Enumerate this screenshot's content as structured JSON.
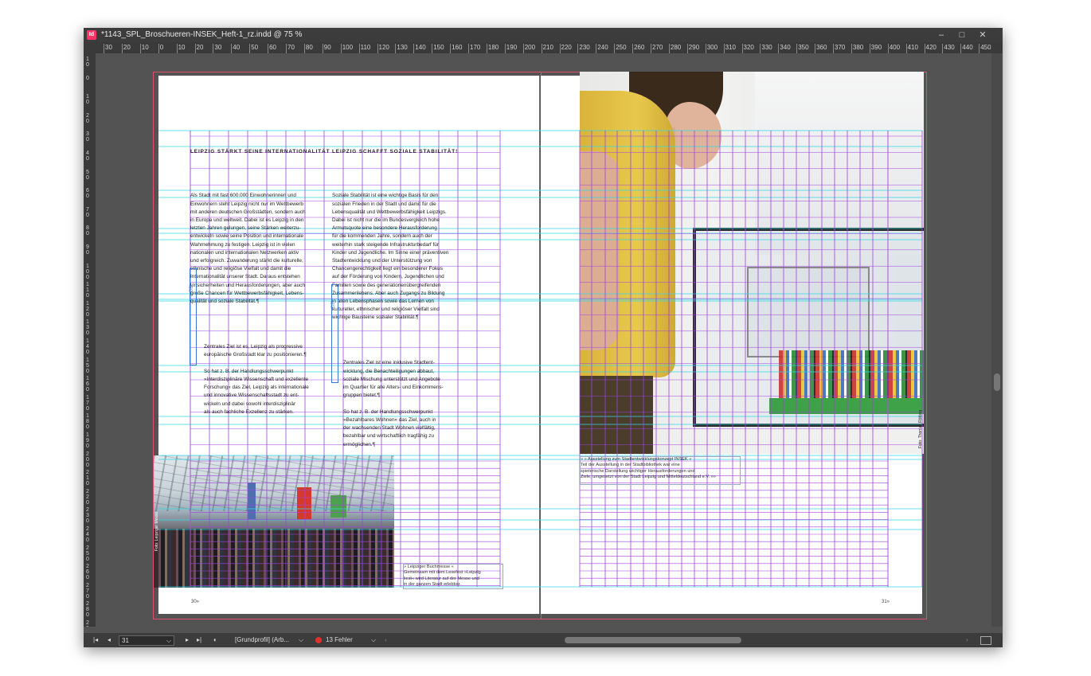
{
  "window": {
    "title": "*1143_SPL_Broschueren-INSEK_Heft-1_rz.indd @ 75 %",
    "app_logo": "Id",
    "buttons": {
      "minimize": "–",
      "maximize": "□",
      "close": "✕"
    }
  },
  "ruler": {
    "horizontal": [
      "30",
      "20",
      "10",
      "0",
      "10",
      "20",
      "30",
      "40",
      "50",
      "60",
      "70",
      "80",
      "90",
      "100",
      "110",
      "120",
      "130",
      "140",
      "150",
      "160",
      "170",
      "180",
      "190",
      "200",
      "210",
      "220",
      "230",
      "240",
      "250",
      "260",
      "270",
      "280",
      "290",
      "300",
      "310",
      "320",
      "330",
      "340",
      "350",
      "360",
      "370",
      "380",
      "390",
      "400",
      "410",
      "420",
      "430",
      "440",
      "450"
    ],
    "vertical": [
      "10",
      "0",
      "10",
      "20",
      "30",
      "40",
      "50",
      "60",
      "70",
      "80",
      "90",
      "100",
      "110",
      "120",
      "130",
      "140",
      "150",
      "160",
      "170",
      "180",
      "190",
      "200",
      "210",
      "220",
      "230",
      "240",
      "250",
      "260",
      "270",
      "280",
      "290"
    ]
  },
  "left_page": {
    "col1_heading": "LEIPZIG STÄRKT SEINE INTERNATIONALITÄT",
    "col1_lines": [
      "Als Stadt mit fast 600.000 Einwohnerinnen und",
      "Einwohnern steht Leipzig nicht nur im Wettbewerb",
      "mit anderen deutschen Großstädten, sondern auch",
      "in Europa und weltweit. Dabei ist es Leipzig in den",
      "letzten Jahren gelungen, seine Stärken weiterzu-",
      "entwickeln sowie seine Position und internationale",
      "Wahrnehmung zu festigen. Leipzig ist in vielen",
      "nationalen und internationalen Netzwerken aktiv",
      "und erfolgreich. Zuwanderung stärkt die kulturelle,",
      "ethnische und religiöse Vielfalt und damit die",
      "Internationalität unserer Stadt. Daraus entstehen",
      "Unsicherheiten und Herausforderungen, aber auch",
      "große Chancen für Wettbewerbsfähigkeit, Lebens-",
      "qualität und soziale Stabilität.¶"
    ],
    "col1_ziel_lines": [
      "Zentrales Ziel ist es, Leipzig als progressive",
      "europäische Großstadt klar zu positionieren.¶",
      "",
      "So hat z. B. der Handlungsschwerpunkt",
      "»Interdisziplinäre Wissenschaft und exzellente",
      "Forschung« das Ziel, Leipzig als internationale",
      "und innovative Wissenschaftsstadt zu ent-",
      "wickeln und dabei sowohl interdisziplinär",
      "als auch fachliche Exzellenz zu stärken."
    ],
    "col2_heading": "LEIPZIG SCHAFFT SOZIALE STABILITÄT!",
    "col2_lines": [
      "Soziale Stabilität ist eine wichtige Basis für den",
      "sozialen Frieden in der Stadt und damit für die",
      "Lebensqualität und Wettbewerbsfähigkeit Leipzigs.",
      "Dabei ist nicht nur die im Bundesvergleich hohe",
      "Armutsquote eine besondere Herausforderung",
      "für die kommenden Jahre, sondern auch der",
      "weiterhin stark steigende Infrastrukturbedarf für",
      "Kinder und Jugendliche. Im Sinne einer präventiven",
      "Stadtentwicklung und der Unterstützung von",
      "Chancengerechtigkeit liegt ein besonderer Fokus",
      "auf der Förderung von Kindern, Jugendlichen und",
      "Familien sowie des generationenübergreifenden",
      "Zusammenlebens. Aber auch Zugangs zu Bildung",
      "in allen Lebensphasen sowie das Lernen von",
      "kultureller, ethnischer und religiöser Vielfalt sind",
      "wichtige Bausteine sozialer Stabilität.¶"
    ],
    "col2_ziel_lines": [
      "Zentrales Ziel ist eine inklusive Stadtent-",
      "wicklung, die Benachteiligungen abbaut,",
      "soziale Mischung unterstützt und Angebote",
      "im Quartier für alle Alters- und Einkommens-",
      "gruppen bietet.¶",
      "",
      "So hat z. B. der Handlungsschwerpunkt",
      "»Bezahlbares Wohnen« das Ziel, auch in",
      "der wachsenden Stadt Wohnen vielfältig,",
      "bezahlbar und wirtschaftlich tragfähig zu",
      "ermöglichen.¶"
    ],
    "ziel_tag": "ZIEL",
    "caption_lines": [
      "» Leipziger Buchmesse «",
      "Gemeinsam mit dem Lesefest »Leipzig",
      "liest« wird Literatur auf der Messe und",
      "in der ganzen Stadt erlebbar."
    ],
    "photo_credit": "Foto: Leipziger Messe",
    "page_number": "30»"
  },
  "right_page": {
    "caption_lines": [
      "» » Ausstellung zum Stadtentwicklungskonzept INSEK «",
      "Teil der Ausstellung in der Stadtbibliothek war eine",
      "spielerische Darstellung wichtiger Herausforderungen und",
      "Ziele, umgesetzt von der Stadt Leipzig und Mitteldeutschland e.V. »»"
    ],
    "photo_credit": "Foto: Thomas Rötting",
    "page_number": "31»"
  },
  "statusbar": {
    "page_field": "31",
    "profile": "[Grundprofil] (Arb...",
    "errors": "13 Fehler",
    "error_color": "#e03030"
  },
  "colors": {
    "margin_guide": "#b050d8",
    "column_guide": "#a040e0",
    "baseline_guide": "#31d8e6",
    "bleed": "#e0506a"
  }
}
